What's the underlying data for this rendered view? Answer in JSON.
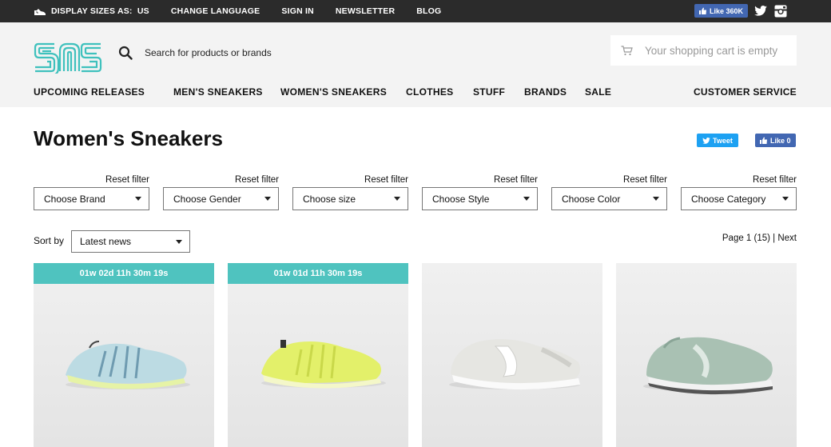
{
  "topbar": {
    "display_sizes_label": "DISPLAY SIZES AS:",
    "display_sizes_value": "US",
    "change_language": "CHANGE LANGUAGE",
    "sign_in": "SIGN IN",
    "newsletter": "NEWSLETTER",
    "blog": "BLOG",
    "fb_like_label": "Like 360K"
  },
  "header": {
    "search_placeholder": "Search for products or brands",
    "cart_text": "Your shopping cart is empty"
  },
  "nav": {
    "items": [
      "UPCOMING RELEASES",
      "MEN'S SNEAKERS",
      "WOMEN'S SNEAKERS",
      "CLOTHES",
      "STUFF",
      "BRANDS",
      "SALE"
    ],
    "customer_service": "CUSTOMER SERVICE"
  },
  "main": {
    "title": "Women's Sneakers",
    "tweet_label": "Tweet",
    "like_label": "Like 0",
    "filters": [
      {
        "reset": "Reset filter",
        "value": "Choose Brand"
      },
      {
        "reset": "Reset filter",
        "value": "Choose Gender"
      },
      {
        "reset": "Reset filter",
        "value": "Choose size"
      },
      {
        "reset": "Reset filter",
        "value": "Choose Style"
      },
      {
        "reset": "Reset filter",
        "value": "Choose Color"
      },
      {
        "reset": "Reset filter",
        "value": "Choose Category"
      }
    ],
    "sort_label": "Sort by",
    "sort_value": "Latest news",
    "pager": "Page 1 (15) | Next"
  },
  "products": [
    {
      "timer": "01w 02d 11h 30m 19s",
      "color": "#bcdbe3"
    },
    {
      "timer": "01w 01d 11h 30m 19s",
      "color": "#e3f06a"
    },
    {
      "timer": "",
      "color": "#e6e6e2"
    },
    {
      "timer": "",
      "color": "#a9c1b3"
    }
  ],
  "colors": {
    "accent": "#4fc3bf",
    "topbar": "#2b2b2b",
    "facebook": "#4267b2",
    "twitter": "#1da1f2"
  }
}
